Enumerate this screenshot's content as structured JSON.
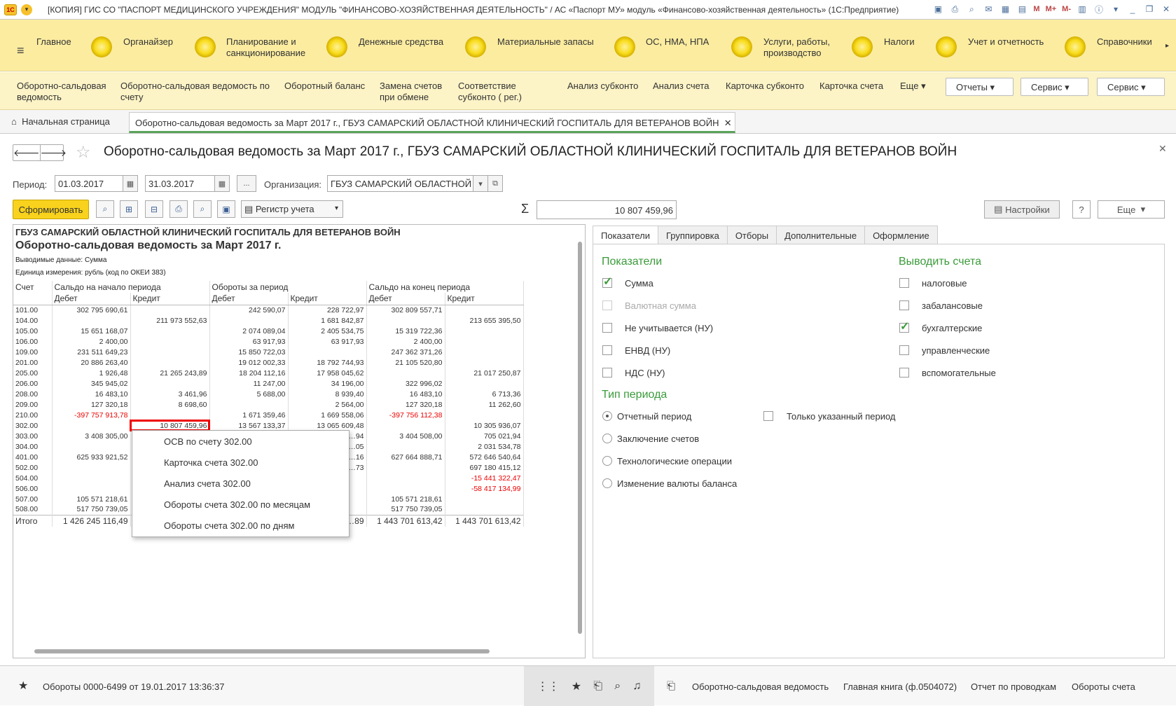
{
  "window": {
    "title": "[КОПИЯ] ГИС СО \"ПАСПОРТ МЕДИЦИНСКОГО УЧРЕЖДЕНИЯ\" МОДУЛЬ \"ФИНАНСОВО-ХОЗЯЙСТВЕННАЯ ДЕЯТЕЛЬНОСТЬ\" / АС «Паспорт МУ» модуль «Финансово-хозяйственная деятельность» (1С:Предприятие)",
    "logo": "1С",
    "tools": {
      "m": "M",
      "mplus": "M+",
      "mminus": "M-"
    }
  },
  "sections": [
    "Главное",
    "Органайзер",
    "Планирование и санкционирование",
    "Денежные средства",
    "Материальные запасы",
    "ОС, НМА, НПА",
    "Услуги, работы, производство",
    "Налоги",
    "Учет и отчетность",
    "Справочники"
  ],
  "subnav": {
    "items": [
      "Оборотно-сальдовая ведомость",
      "Оборотно-сальдовая ведомость по счету",
      "Оборотный баланс",
      "Замена счетов при обмене",
      "Соответствие субконто ( рег.)",
      "Анализ субконто",
      "Анализ счета",
      "Карточка субконто",
      "Карточка счета",
      "Еще ▾"
    ],
    "buttons": [
      "Отчеты",
      "Сервис",
      "Сервис"
    ]
  },
  "tabs": {
    "home": "Начальная страница",
    "active": "Оборотно-сальдовая ведомость за Март 2017 г., ГБУЗ САМАРСКИЙ ОБЛАСТНОЙ КЛИНИЧЕСКИЙ ГОСПИТАЛЬ ДЛЯ ВЕТЕРАНОВ ВОЙН"
  },
  "form": {
    "title": "Оборотно-сальдовая ведомость за Март 2017 г., ГБУЗ САМАРСКИЙ ОБЛАСТНОЙ КЛИНИЧЕСКИЙ ГОСПИТАЛЬ ДЛЯ ВЕТЕРАНОВ ВОЙН",
    "period_label": "Период:",
    "date_from": "01.03.2017",
    "date_to": "31.03.2017",
    "dots": "...",
    "org_label": "Организация:",
    "org_value": "ГБУЗ САМАРСКИЙ ОБЛАСТНОЙ",
    "generate": "Сформировать",
    "register": "Регистр учета",
    "sigma": "Σ",
    "sum": "10 807 459,96",
    "settings": "Настройки",
    "help": "?",
    "more": "Еще"
  },
  "report": {
    "org": "ГБУЗ САМАРСКИЙ ОБЛАСТНОЙ КЛИНИЧЕСКИЙ ГОСПИТАЛЬ ДЛЯ ВЕТЕРАНОВ ВОЙН",
    "title": "Оборотно-сальдовая ведомость за Март 2017 г.",
    "output": "Выводимые данные:  Сумма",
    "unit": "Единица измерения: рубль (код по ОКЕИ 383)",
    "h1": [
      "Счет",
      "Сальдо на начало периода",
      "Обороты за период",
      "Сальдо на конец периода"
    ],
    "h2": [
      "Дебет",
      "Кредит",
      "Дебет",
      "Кредит",
      "Дебет",
      "Кредит"
    ],
    "rows": [
      [
        "101.00",
        "302 795 690,61",
        "",
        "242 590,07",
        "228 722,97",
        "302 809 557,71",
        ""
      ],
      [
        "104.00",
        "",
        "211 973 552,63",
        "",
        "1 681 842,87",
        "",
        "213 655 395,50"
      ],
      [
        "105.00",
        "15 651 168,07",
        "",
        "2 074 089,04",
        "2 405 534,75",
        "15 319 722,36",
        ""
      ],
      [
        "106.00",
        "2 400,00",
        "",
        "63 917,93",
        "63 917,93",
        "2 400,00",
        ""
      ],
      [
        "109.00",
        "231 511 649,23",
        "",
        "15 850 722,03",
        "",
        "247 362 371,26",
        ""
      ],
      [
        "201.00",
        "20 886 263,40",
        "",
        "19 012 002,33",
        "18 792 744,93",
        "21 105 520,80",
        ""
      ],
      [
        "205.00",
        "1 926,48",
        "21 265 243,89",
        "18 204 112,16",
        "17 958 045,62",
        "",
        "21 017 250,87"
      ],
      [
        "206.00",
        "345 945,02",
        "",
        "11 247,00",
        "34 196,00",
        "322 996,02",
        ""
      ],
      [
        "208.00",
        "16 483,10",
        "3 461,96",
        "5 688,00",
        "8 939,40",
        "16 483,10",
        "6 713,36"
      ],
      [
        "209.00",
        "127 320,18",
        "8 698,60",
        "",
        "2 564,00",
        "127 320,18",
        "11 262,60"
      ],
      [
        "210.00",
        "-397 757 913,78",
        "",
        "1 671 359,46",
        "1 669 558,06",
        "-397 756 112,38",
        ""
      ],
      [
        "302.00",
        "",
        "10 807 459,96",
        "13 567 133,37",
        "13 065 609,48",
        "",
        "10 305 936,07"
      ],
      [
        "303.00",
        "3 408 305,00",
        "",
        "",
        "…94",
        "3 404 508,00",
        "705 021,94"
      ],
      [
        "304.00",
        "",
        "",
        "",
        "…05",
        "",
        "2 031 534,78"
      ],
      [
        "401.00",
        "625 933 921,52",
        "",
        "",
        "…16",
        "627 664 888,71",
        "572 646 540,64"
      ],
      [
        "502.00",
        "",
        "",
        "",
        "…73",
        "",
        "697 180 415,12"
      ],
      [
        "504.00",
        "",
        "",
        "",
        "",
        "",
        "-15 441 322,47"
      ],
      [
        "506.00",
        "",
        "",
        "",
        "",
        "",
        "-58 417 134,99"
      ],
      [
        "507.00",
        "105 571 218,61",
        "",
        "",
        "",
        "105 571 218,61",
        ""
      ],
      [
        "508.00",
        "517 750 739,05",
        "",
        "",
        "",
        "517 750 739,05",
        ""
      ]
    ],
    "total": [
      "Итого",
      "1 426 245 116,49",
      "",
      "",
      "…89",
      "1 443 701 613,42",
      "1 443 701 613,42"
    ]
  },
  "context_menu": [
    "ОСВ по счету 302.00",
    "Карточка счета 302.00",
    "Анализ счета 302.00",
    "Обороты счета 302.00 по месяцам",
    "Обороты счета 302.00 по дням"
  ],
  "settings": {
    "tabs": [
      "Показатели",
      "Группировка",
      "Отборы",
      "Дополнительные",
      "Оформление"
    ],
    "indicators_title": "Показатели",
    "indicators": [
      "Сумма",
      "Валютная сумма",
      "Не учитывается (НУ)",
      "ЕНВД (НУ)",
      "НДС (НУ)"
    ],
    "accounts_title": "Выводить счета",
    "accounts": [
      "налоговые",
      "забалансовые",
      "бухгалтерские",
      "управленческие",
      "вспомогательные"
    ],
    "period_title": "Тип периода",
    "period_types": [
      "Отчетный период",
      "Заключение счетов",
      "Технологические операции",
      "Изменение валюты баланса"
    ],
    "only_period": "Только указанный период"
  },
  "status": {
    "left": "Обороты 0000-6499 от 19.01.2017 13:36:37",
    "links": [
      "Оборотно-сальдовая ведомость",
      "Главная книга (ф.0504072)",
      "Отчет по проводкам",
      "Обороты счета"
    ]
  },
  "colors": {
    "accent_yellow": "#f8d21c",
    "section_bg": "#fbeca0",
    "green": "#3a9b3a",
    "negative": "#e00000"
  }
}
